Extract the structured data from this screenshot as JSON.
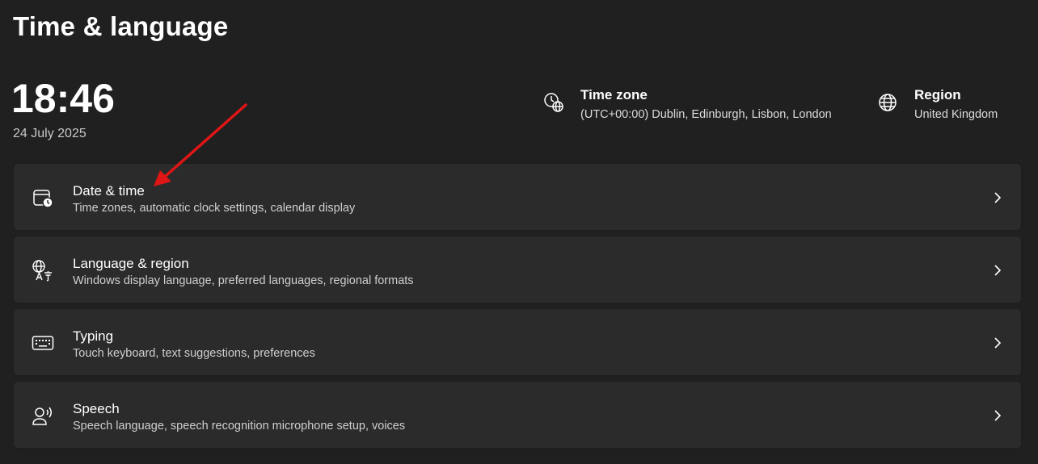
{
  "page": {
    "title": "Time & language"
  },
  "clock": {
    "time": "18:46",
    "date": "24 July 2025"
  },
  "time_zone": {
    "icon": "time-zone-globe-clock-icon",
    "title": "Time zone",
    "value": "(UTC+00:00) Dublin, Edinburgh, Lisbon, London"
  },
  "region": {
    "icon": "globe-icon",
    "title": "Region",
    "value": "United Kingdom"
  },
  "cards": [
    {
      "icon": "calendar-clock-icon",
      "title": "Date & time",
      "description": "Time zones, automatic clock settings, calendar display"
    },
    {
      "icon": "language-icon",
      "title": "Language & region",
      "description": "Windows display language, preferred languages, regional formats"
    },
    {
      "icon": "keyboard-icon",
      "title": "Typing",
      "description": "Touch keyboard, text suggestions, preferences"
    },
    {
      "icon": "speech-icon",
      "title": "Speech",
      "description": "Speech language, speech recognition microphone setup, voices"
    }
  ],
  "colors": {
    "background": "#202020",
    "card": "#2b2b2b",
    "annotation_arrow": "#e01515"
  }
}
